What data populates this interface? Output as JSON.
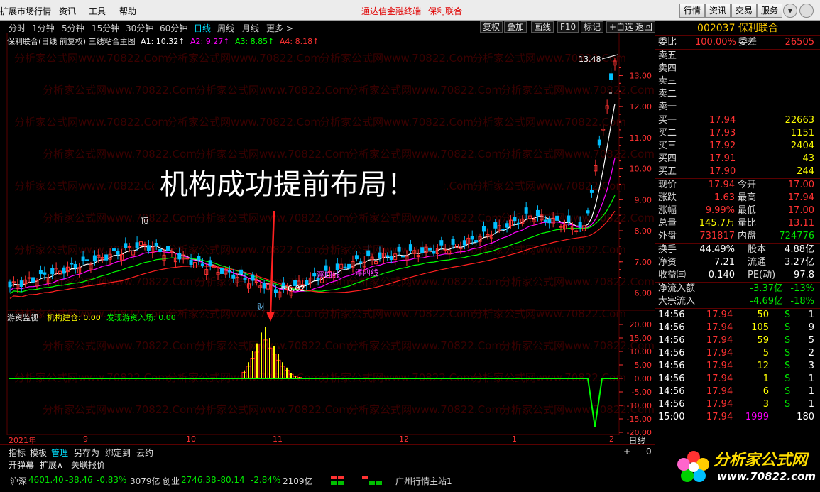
{
  "menu": {
    "items": [
      "扩展市场行情",
      "资讯",
      "工具",
      "帮助"
    ],
    "promo": [
      "通达信金融终端",
      "保利联合"
    ],
    "right_buttons": [
      "行情",
      "资讯",
      "交易",
      "服务"
    ],
    "window_buttons": [
      "▾",
      "–",
      "✕"
    ]
  },
  "periods": {
    "items": [
      "分时",
      "1分钟",
      "5分钟",
      "15分钟",
      "30分钟",
      "60分钟",
      "日线",
      "周线",
      "月线",
      "更多 >"
    ],
    "active": "日线"
  },
  "tools": [
    "复权",
    "叠加",
    "画线",
    "F10",
    "标记",
    "+自选",
    "返回"
  ],
  "chart_info": {
    "title": "保利联合(日线 前复权) 三线粘合主图",
    "a1": "A1: 10.32↑",
    "a2": "A2: 9.27↑",
    "a3": "A3: 8.85↑",
    "a4": "A4: 8.18↑"
  },
  "colors": {
    "up": "#ff3232",
    "down": "#00c0ff",
    "ma1": "#ffffff",
    "ma2": "#ff00ff",
    "ma3": "#00ff00",
    "ma4": "#ff2020",
    "axis": "#ff3232"
  },
  "annotations": {
    "top_label": "顶",
    "wealth_label": "财",
    "low_price": "6.02",
    "high_price": "13.48",
    "signal_label_1": "浮四线",
    "signal_label_2": "浮四线"
  },
  "overlay_caption": "机构成功提前布局！",
  "indicator": {
    "name": "游资监视",
    "line1": "机构建仓: 0.00",
    "line2": "发现游资入场: 0.00",
    "ticks": [
      "20.00",
      "15.00",
      "10.00",
      "5.00",
      "0.00",
      "-5.00",
      "-10.00",
      "-15.00",
      "-20.00"
    ]
  },
  "chart_data": {
    "type": "candlestick",
    "ylim": [
      5.6,
      13.9
    ],
    "price_ticks": [
      "13.00",
      "12.00",
      "11.00",
      "10.00",
      "9.00",
      "8.00",
      "7.00",
      "6.00"
    ],
    "time_labels": [
      "2021年",
      "9",
      "10",
      "11",
      "12",
      "1",
      "2"
    ],
    "period_label": "日线"
  },
  "quote": {
    "code": "002037",
    "name": "保利联合",
    "webi_label": "委比",
    "webi": "100.00%",
    "weicha_label": "委差",
    "weicha": "26505",
    "sells": [
      {
        "label": "卖五",
        "price": "",
        "vol": ""
      },
      {
        "label": "卖四",
        "price": "",
        "vol": ""
      },
      {
        "label": "卖三",
        "price": "",
        "vol": ""
      },
      {
        "label": "卖二",
        "price": "",
        "vol": ""
      },
      {
        "label": "卖一",
        "price": "",
        "vol": ""
      }
    ],
    "buys": [
      {
        "label": "买一",
        "price": "17.94",
        "vol": "22663"
      },
      {
        "label": "买二",
        "price": "17.93",
        "vol": "1151"
      },
      {
        "label": "买三",
        "price": "17.92",
        "vol": "2404"
      },
      {
        "label": "买四",
        "price": "17.91",
        "vol": "43"
      },
      {
        "label": "买五",
        "price": "17.90",
        "vol": "244"
      }
    ],
    "stats": [
      {
        "l1": "现价",
        "v1": "17.94",
        "l2": "今开",
        "v2": "17.00"
      },
      {
        "l1": "涨跌",
        "v1": "1.63",
        "l2": "最高",
        "v2": "17.94"
      },
      {
        "l1": "涨幅",
        "v1": "9.99%",
        "l2": "最低",
        "v2": "17.00"
      },
      {
        "l1": "总量",
        "v1": "145.7万",
        "l2": "量比",
        "v2": "13.11"
      },
      {
        "l1": "外盘",
        "v1": "731817",
        "l2": "内盘",
        "v2": "724776"
      }
    ],
    "stats2": [
      {
        "l1": "换手",
        "v1": "44.49%",
        "l2": "股本",
        "v2": "4.88亿"
      },
      {
        "l1": "净资",
        "v1": "7.21",
        "l2": "流通",
        "v2": "3.27亿"
      },
      {
        "l1": "收益㈢",
        "v1": "0.140",
        "l2": "PE(动)",
        "v2": "97.8"
      }
    ],
    "flows": [
      {
        "label": "净流入额",
        "value": "-3.37亿",
        "pct": "-13%"
      },
      {
        "label": "大宗流入",
        "value": "-4.69亿",
        "pct": "-18%"
      }
    ],
    "ticks": [
      {
        "time": "14:56",
        "price": "17.94",
        "vol": "50",
        "side": "S",
        "n": "1"
      },
      {
        "time": "14:56",
        "price": "17.94",
        "vol": "105",
        "side": "S",
        "n": "9"
      },
      {
        "time": "14:56",
        "price": "17.94",
        "vol": "59",
        "side": "S",
        "n": "5"
      },
      {
        "time": "14:56",
        "price": "17.94",
        "vol": "5",
        "side": "S",
        "n": "2"
      },
      {
        "time": "14:56",
        "price": "17.94",
        "vol": "12",
        "side": "S",
        "n": "3"
      },
      {
        "time": "14:56",
        "price": "17.94",
        "vol": "1",
        "side": "S",
        "n": "1"
      },
      {
        "time": "14:56",
        "price": "17.94",
        "vol": "6",
        "side": "S",
        "n": "1"
      },
      {
        "time": "14:56",
        "price": "17.94",
        "vol": "3",
        "side": "S",
        "n": "1"
      },
      {
        "time": "15:00",
        "price": "17.94",
        "vol": "1999",
        "side": "",
        "n": "180"
      }
    ]
  },
  "bottom_tabs": [
    "指标",
    "模板",
    "管理",
    "另存为",
    "绑定到",
    "云约"
  ],
  "bottom_tabs_active": "管理",
  "bottom_tabs2": [
    "开弹幕",
    "扩展∧",
    "关联报价"
  ],
  "zoom_controls": [
    "+",
    "-",
    "0"
  ],
  "status": {
    "idx1_name": "沪深",
    "idx1_value": "4601.40",
    "idx1_change": "-38.46",
    "idx1_pct": "-0.83%",
    "idx1_amt": "3079亿",
    "idx2_name": "创业",
    "idx2_value": "2746.38",
    "idx2_change": "-80.14",
    "idx2_pct": "-2.84%",
    "idx2_amt": "2109亿",
    "server": "广州行情主站1"
  },
  "logo": {
    "text": "分析家公式网",
    "url": "www.70822.com"
  },
  "watermark": "分析家公式网www.70822.Com"
}
